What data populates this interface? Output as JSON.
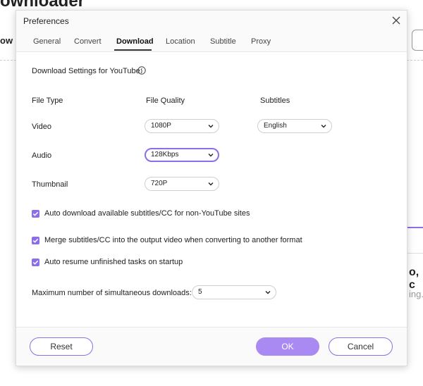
{
  "background": {
    "title": "ownloader",
    "word": "ow",
    "text1": "o, c",
    "text2": "ing."
  },
  "dialog": {
    "title": "Preferences",
    "tabs": [
      {
        "label": "General"
      },
      {
        "label": "Convert"
      },
      {
        "label": "Download"
      },
      {
        "label": "Location"
      },
      {
        "label": "Subtitle"
      },
      {
        "label": "Proxy"
      }
    ],
    "active_tab": "Download",
    "section_title": "Download Settings for YouTube:",
    "columns": {
      "file_type": "File Type",
      "file_quality": "File Quality",
      "subtitles": "Subtitles"
    },
    "rows": {
      "video": {
        "label": "Video",
        "quality": "1080P",
        "subtitles": "English"
      },
      "audio": {
        "label": "Audio",
        "quality": "128Kbps"
      },
      "thumbnail": {
        "label": "Thumbnail",
        "quality": "720P"
      }
    },
    "checkboxes": [
      {
        "label": "Auto download available subtitles/CC for non-YouTube sites",
        "checked": true
      },
      {
        "label": "Merge subtitles/CC into the output video when converting to another format",
        "checked": true
      },
      {
        "label": "Auto resume unfinished tasks on startup",
        "checked": true
      }
    ],
    "max_downloads": {
      "label": "Maximum number of simultaneous downloads:",
      "value": "5"
    },
    "buttons": {
      "reset": "Reset",
      "ok": "OK",
      "cancel": "Cancel"
    }
  },
  "colors": {
    "accent": "#8c6ee8",
    "primary_button": "#a98af2"
  }
}
